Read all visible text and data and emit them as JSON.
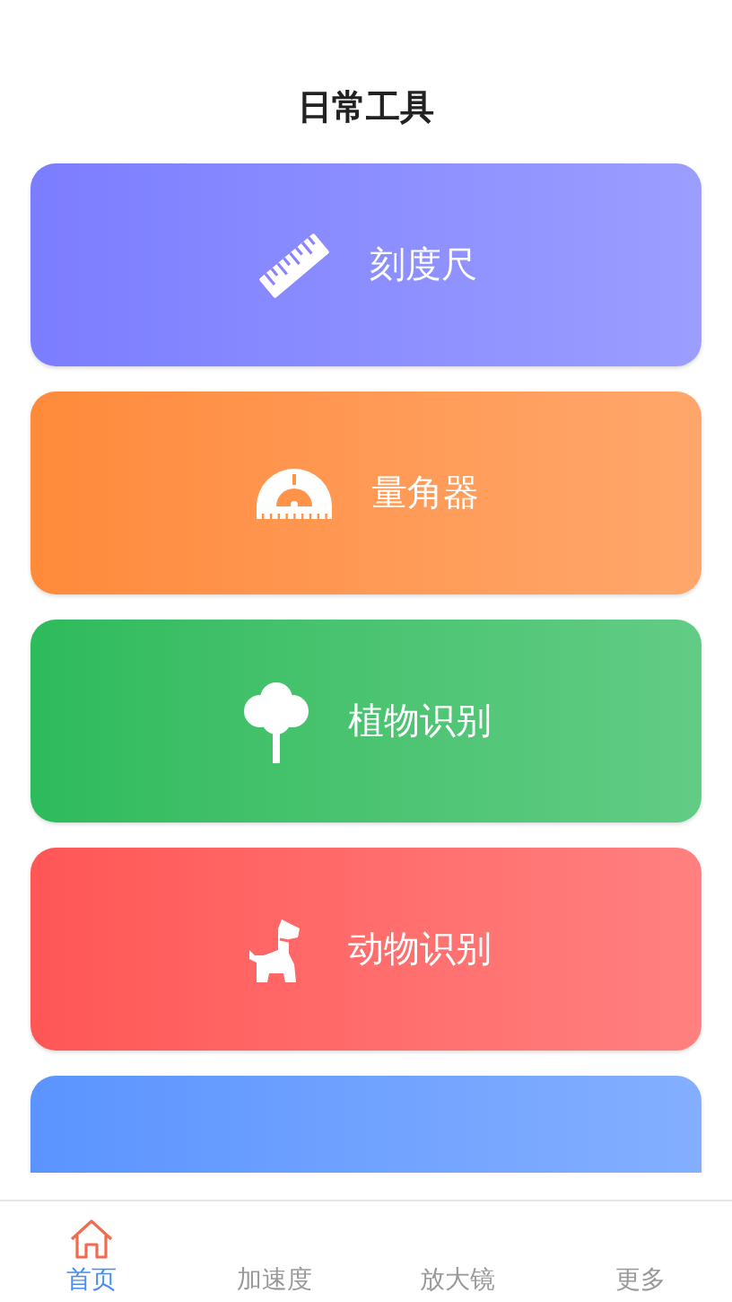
{
  "title": "日常工具",
  "cards": [
    {
      "kind": "ruler",
      "label": "刻度尺",
      "color": "#7b7dff"
    },
    {
      "kind": "protractor",
      "label": "量角器",
      "color": "#ff8a3a"
    },
    {
      "kind": "tree",
      "label": "植物识别",
      "color": "#2dbb5c"
    },
    {
      "kind": "dog",
      "label": "动物识别",
      "color": "#ff5656"
    },
    {
      "kind": "partial",
      "color": "#5b94ff"
    }
  ],
  "tabs": [
    {
      "label": "首页",
      "selected": true
    },
    {
      "label": "加速度",
      "selected": false
    },
    {
      "label": "放大镜",
      "selected": false
    },
    {
      "label": "更多",
      "selected": false
    }
  ]
}
